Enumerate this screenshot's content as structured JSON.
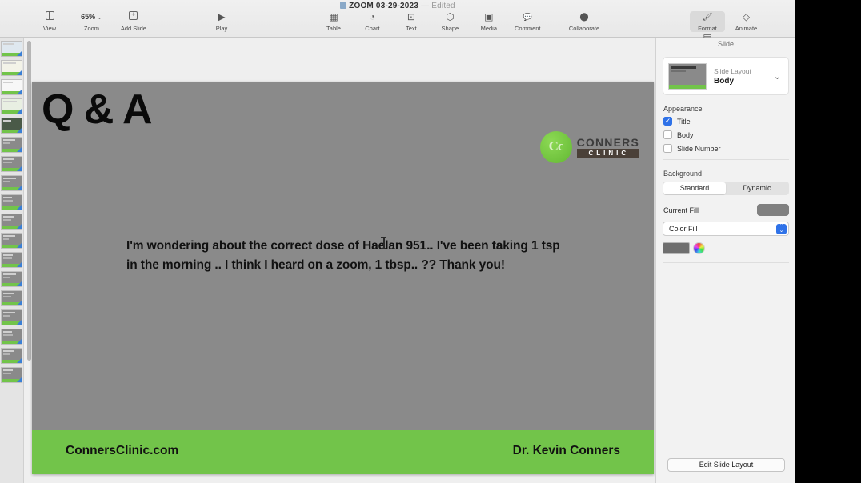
{
  "window": {
    "title": "ZOOM 03-29-2023",
    "separator": "—",
    "edited_label": "Edited"
  },
  "toolbar": {
    "left_items": [
      {
        "label": "View",
        "icon": "sidebar-icon"
      },
      {
        "label": "Add Slide",
        "icon": "plus-square-icon"
      }
    ],
    "zoom": {
      "value": "65%",
      "label": "Zoom",
      "chevron": "⌄"
    },
    "play": {
      "label": "Play",
      "icon": "play-icon",
      "glyph": "▶"
    },
    "insert_items": [
      {
        "label": "Table",
        "icon": "table-icon",
        "glyph": "▦"
      },
      {
        "label": "Chart",
        "icon": "chart-icon",
        "glyph": "◔"
      },
      {
        "label": "Text",
        "icon": "text-icon",
        "glyph": "⊡"
      },
      {
        "label": "Shape",
        "icon": "shape-icon",
        "glyph": "⬡"
      },
      {
        "label": "Media",
        "icon": "media-icon",
        "glyph": "▣"
      },
      {
        "label": "Comment",
        "icon": "comment-icon",
        "glyph": "💬"
      }
    ],
    "collaborate": {
      "label": "Collaborate",
      "icon": "collaborate-icon",
      "glyph": "⬤"
    },
    "right_items": [
      {
        "label": "Format",
        "icon": "paintbrush-icon",
        "glyph": "🖌",
        "active": true
      },
      {
        "label": "Animate",
        "icon": "animate-icon",
        "glyph": "◇"
      },
      {
        "label": "Document",
        "icon": "document-icon",
        "glyph": "▤"
      }
    ]
  },
  "inspector": {
    "header": "Slide",
    "slide_layout": {
      "label": "Slide Layout",
      "value": "Body",
      "chevron": "⌄"
    },
    "appearance": {
      "title": "Appearance",
      "options": [
        {
          "label": "Title",
          "checked": true
        },
        {
          "label": "Body",
          "checked": false
        },
        {
          "label": "Slide Number",
          "checked": false
        }
      ]
    },
    "background": {
      "title": "Background",
      "segments": [
        {
          "label": "Standard",
          "selected": true
        },
        {
          "label": "Dynamic",
          "selected": false
        }
      ],
      "current_fill_label": "Current Fill",
      "current_fill_color": "#808080",
      "fill_type": "Color Fill",
      "fill_color": "#6f6f6f"
    },
    "edit_slide_layout_button": "Edit Slide Layout"
  },
  "slide": {
    "title": "Q & A",
    "body_line1": "I'm wondering about the correct dose of Haelan 951.. I've been taking 1 tsp",
    "body_line2": "in the morning .. I think I heard on a zoom, 1 tbsp.. ?? Thank you!",
    "logo": {
      "mark": "Cc",
      "name": "CONNERS",
      "subtitle": "CLINIC"
    },
    "footer_left": "ConnersClinic.com",
    "footer_right": "Dr. Kevin Conners",
    "background_color": "#8a8a8a",
    "accent_color": "#72c44a"
  },
  "thumbnails": {
    "count": 17,
    "selected_index": 11
  }
}
